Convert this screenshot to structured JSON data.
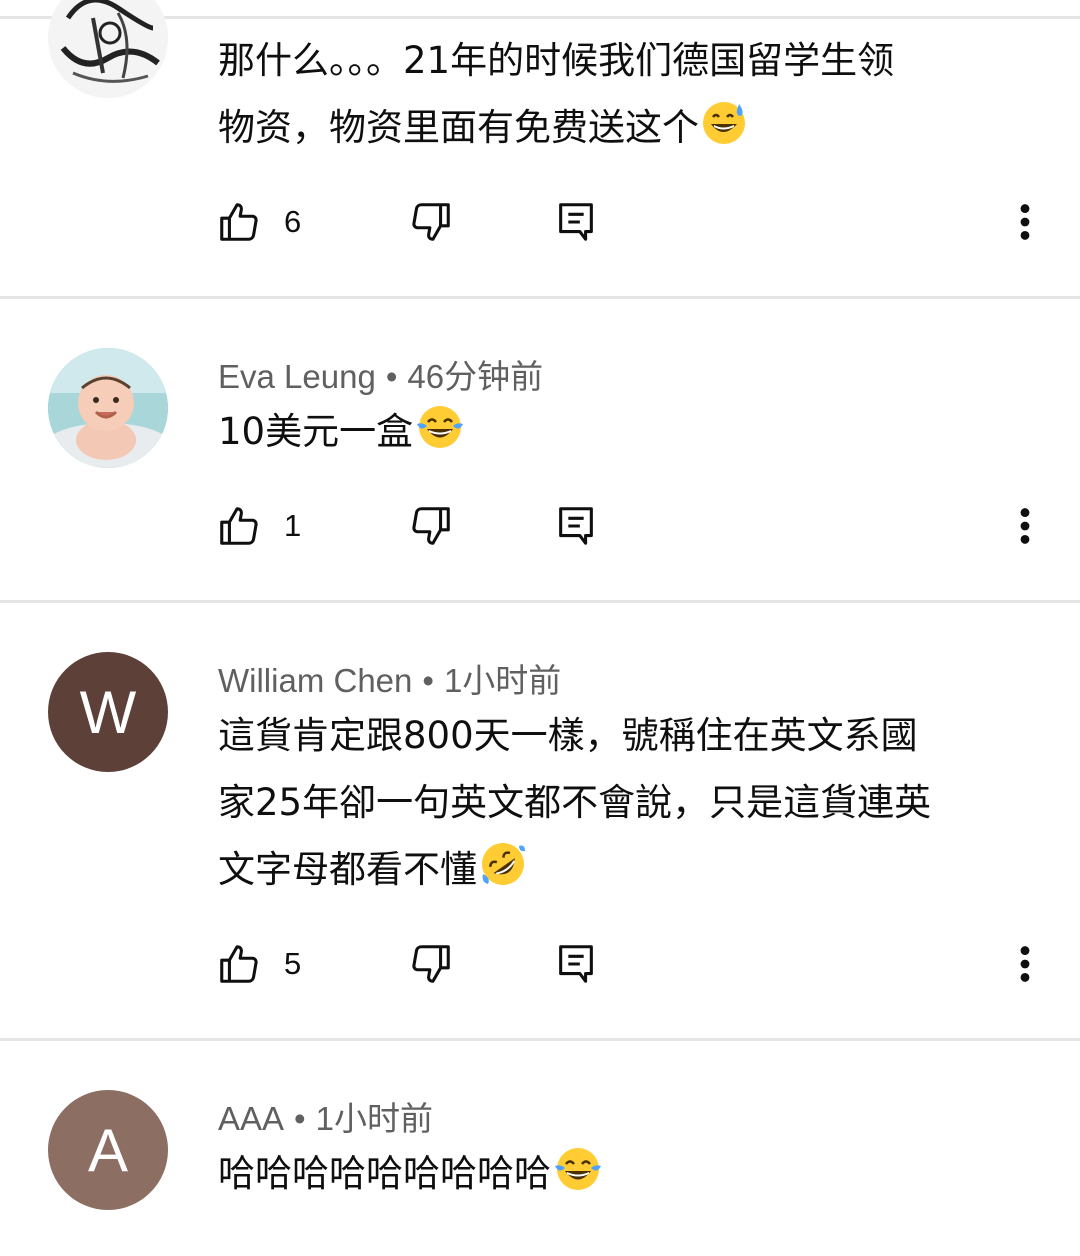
{
  "colors": {
    "divider": "#e5e5e5",
    "meta_text": "#606060",
    "body_text": "#0f0f0f",
    "avatar_william": "#5d4037",
    "avatar_aaa": "#8d6e63"
  },
  "meta_separator": "•",
  "comments": [
    {
      "author": "",
      "time": "",
      "avatar": {
        "type": "image",
        "icon": "sketch-avatar"
      },
      "text_lines": [
        "那什么。。。21年的时候我们德国留学生领",
        "物资，物资里面有免费送这个"
      ],
      "emoji": "sweat-smile-emoji",
      "likes": "6"
    },
    {
      "author": "Eva Leung",
      "time": "46分钟前",
      "avatar": {
        "type": "image",
        "icon": "baby-photo-avatar"
      },
      "text_lines": [
        "10美元一盒"
      ],
      "emoji": "tears-of-joy-emoji",
      "likes": "1"
    },
    {
      "author": "William Chen",
      "time": "1小时前",
      "avatar": {
        "type": "letter",
        "letter": "W"
      },
      "text_lines": [
        "這貨肯定跟800天一樣，號稱住在英文系國",
        "家25年卻一句英文都不會說，只是這貨連英",
        "文字母都看不懂"
      ],
      "emoji": "rolling-laughing-emoji",
      "likes": "5"
    },
    {
      "author": "AAA",
      "time": "1小时前",
      "avatar": {
        "type": "letter",
        "letter": "A"
      },
      "text_lines": [
        "哈哈哈哈哈哈哈哈哈"
      ],
      "emoji": "tears-of-joy-emoji",
      "likes": ""
    }
  ]
}
